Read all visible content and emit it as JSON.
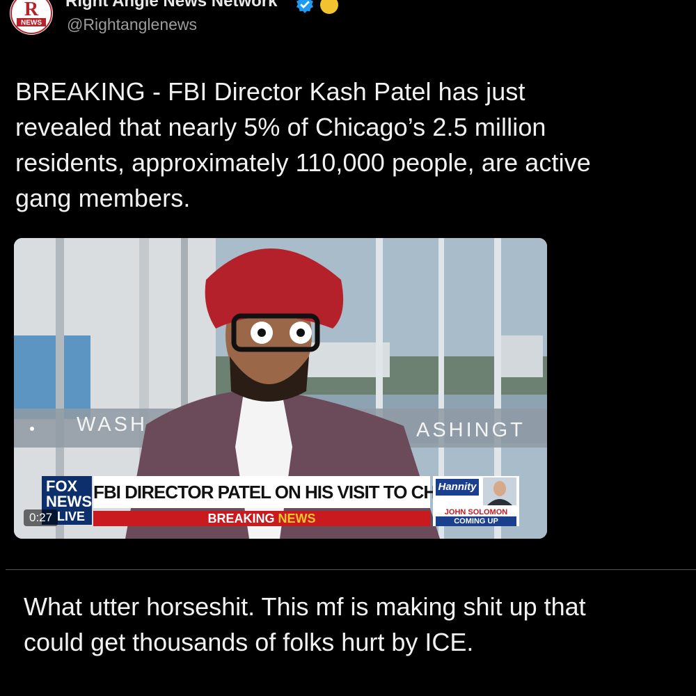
{
  "author": {
    "display_name": "Right Angle News Network",
    "handle": "@Rightanglenews",
    "avatar_text": "R",
    "avatar_subtext": "NEWS",
    "verified_icon": "verified-badge-icon",
    "affiliate_icon": "gold-circle-icon"
  },
  "tweet": {
    "text_lines": [
      "BREAKING - FBI Director Kash Patel has just",
      "revealed that nearly 5% of Chicago’s 2.5 million",
      "residents, approximately 110,000 people, are active",
      "gang members."
    ]
  },
  "video": {
    "timestamp": "0:27",
    "backdrop_left_text": "WASH",
    "backdrop_right_text": "ASHINGT",
    "network": {
      "line1": "FOX",
      "line2": "NEWS",
      "line3": "LIVE"
    },
    "chyron_headline": "FBI DIRECTOR PATEL ON HIS VISIT TO CHICAGO",
    "chyron_breaking": "BREAKING",
    "chyron_news": "NEWS",
    "promo": {
      "show": "Hannity",
      "name": "JOHN SOLOMON",
      "status": "COMING UP"
    }
  },
  "comment": {
    "text_lines": [
      "What utter horseshit. This mf is making shit up that",
      "could get thousands of folks hurt by ICE."
    ]
  },
  "colors": {
    "background": "#000000",
    "text": "#f2f2f2",
    "handle": "#9c9c9c",
    "verified": "#1d9bf0",
    "fox_blue": "#0d2f6b",
    "breaking_red": "#c81a1f",
    "news_gold": "#f4c430"
  }
}
